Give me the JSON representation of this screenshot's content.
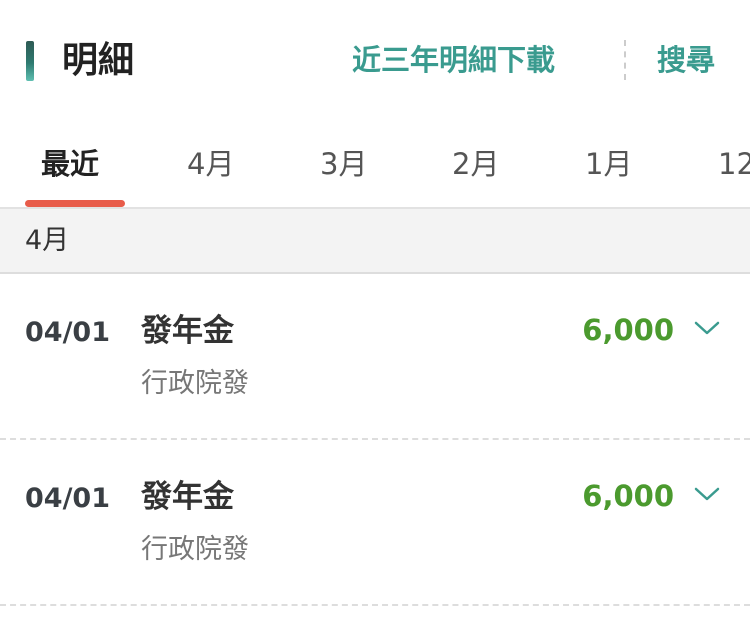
{
  "colors": {
    "accent_teal": "#3a9b8f",
    "tab_underline": "#e85c4a",
    "amount_green": "#4b9a2e",
    "chevron_teal": "#3a9b8f"
  },
  "header": {
    "title": "明細",
    "download_label": "近三年明細下載",
    "search_label": "搜尋"
  },
  "tabs": [
    {
      "label": "最近",
      "active": true
    },
    {
      "label": "4月",
      "active": false
    },
    {
      "label": "3月",
      "active": false
    },
    {
      "label": "2月",
      "active": false
    },
    {
      "label": "1月",
      "active": false
    },
    {
      "label": "12",
      "active": false
    }
  ],
  "section": {
    "label": "4月"
  },
  "items": [
    {
      "date": "04/01",
      "title": "發年金",
      "subtitle": "行政院發",
      "amount": "6,000",
      "icon": "chevron-down-icon"
    },
    {
      "date": "04/01",
      "title": "發年金",
      "subtitle": "行政院發",
      "amount": "6,000",
      "icon": "chevron-down-icon"
    }
  ]
}
